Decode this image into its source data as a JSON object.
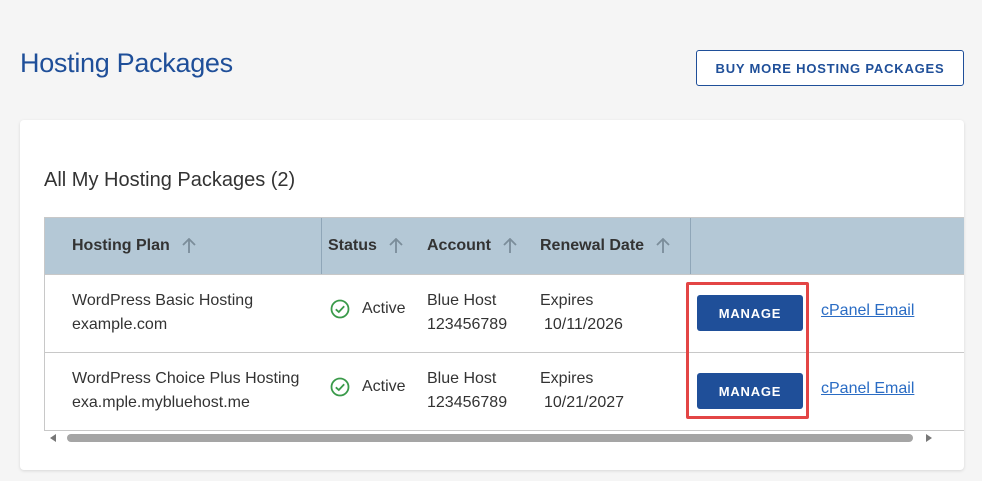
{
  "page": {
    "title": "Hosting Packages",
    "buy_button_label": "BUY MORE HOSTING PACKAGES"
  },
  "card": {
    "title": "All My Hosting Packages (2)"
  },
  "table": {
    "columns": [
      {
        "label": "Hosting Plan",
        "icon": "sort-arrow-up-icon"
      },
      {
        "label": "Status",
        "icon": "sort-arrow-up-icon"
      },
      {
        "label": "Account",
        "icon": "sort-arrow-up-icon"
      },
      {
        "label": "Renewal Date",
        "icon": "sort-arrow-up-icon"
      },
      {
        "label": ""
      }
    ],
    "rows": [
      {
        "plan": "WordPress Basic Hosting",
        "domain": "example.com",
        "status": "Active",
        "status_icon": "check-circle-icon",
        "account_name": "Blue Host",
        "account_number": "123456789",
        "renewal_label": "Expires",
        "renewal_date": "10/11/2026",
        "manage_label": "MANAGE",
        "email_link": "cPanel Email"
      },
      {
        "plan": "WordPress Choice Plus Hosting",
        "domain": "exa.mple.mybluehost.me",
        "status": "Active",
        "status_icon": "check-circle-icon",
        "account_name": "Blue Host",
        "account_number": "123456789",
        "renewal_label": "Expires",
        "renewal_date": "10/21/2027",
        "manage_label": "MANAGE",
        "email_link": "cPanel Email"
      }
    ]
  },
  "colors": {
    "brand_blue": "#1f4f99",
    "header_bg": "#b4c8d6",
    "link_blue": "#2a6cc4",
    "status_green": "#3a9a4a",
    "highlight_red": "#e34545"
  }
}
